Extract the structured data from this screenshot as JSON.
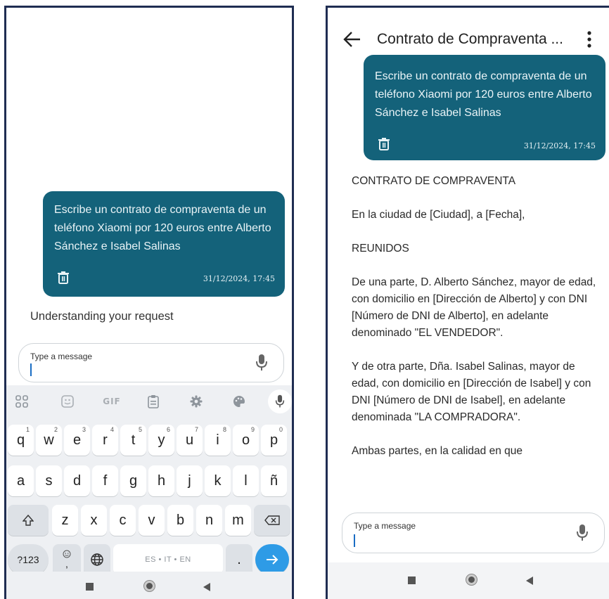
{
  "message": {
    "text": "Escribe un contrato de compraventa de un teléfono Xiaomi por 120 euros entre Alberto Sánchez e Isabel Salinas",
    "timestamp": "31/12/2024, 17:45"
  },
  "left_screen": {
    "status_text": "Understanding your request",
    "input": {
      "placeholder": "Type a message"
    },
    "keyboard": {
      "toolbar": {
        "gif_label": "GIF"
      },
      "row1": [
        {
          "k": "q",
          "h": "1"
        },
        {
          "k": "w",
          "h": "2"
        },
        {
          "k": "e",
          "h": "3"
        },
        {
          "k": "r",
          "h": "4"
        },
        {
          "k": "t",
          "h": "5"
        },
        {
          "k": "y",
          "h": "6"
        },
        {
          "k": "u",
          "h": "7"
        },
        {
          "k": "i",
          "h": "8"
        },
        {
          "k": "o",
          "h": "9"
        },
        {
          "k": "p",
          "h": "0"
        }
      ],
      "row2": [
        "a",
        "s",
        "d",
        "f",
        "g",
        "h",
        "j",
        "k",
        "l",
        "ñ"
      ],
      "row3": [
        "z",
        "x",
        "c",
        "v",
        "b",
        "n",
        "m"
      ],
      "symbols_key": "?123",
      "comma_key": ",",
      "space_label": "ES • IT • EN",
      "period_key": "."
    }
  },
  "right_screen": {
    "title": "Contrato de Compraventa ...",
    "contract_paragraphs": [
      "CONTRATO DE COMPRAVENTA",
      "En la ciudad de [Ciudad], a [Fecha],",
      "REUNIDOS",
      "De una parte, D. Alberto Sánchez, mayor de edad, con domicilio en [Dirección de Alberto] y con DNI [Número de DNI de Alberto], en adelante denominado \"EL VENDEDOR\".",
      "Y de otra parte, Dña. Isabel Salinas, mayor de edad, con domicilio en [Dirección de Isabel] y con DNI [Número de DNI de Isabel], en adelante denominada \"LA COMPRADORA\".",
      "Ambas partes, en la calidad en que"
    ],
    "input": {
      "placeholder": "Type a message"
    }
  },
  "colors": {
    "bubble": "#14627a",
    "frame": "#1f2d52",
    "enter_key": "#2e9be6"
  },
  "icons": [
    "trash-icon",
    "mic-icon",
    "back-arrow-icon",
    "more-vert-icon",
    "apps-grid-icon",
    "sticker-icon",
    "clipboard-icon",
    "settings-gear-icon",
    "palette-icon",
    "shift-icon",
    "backspace-icon",
    "emoji-icon",
    "globe-icon",
    "enter-arrow-icon",
    "nav-recents-icon",
    "nav-home-icon",
    "nav-back-icon"
  ]
}
